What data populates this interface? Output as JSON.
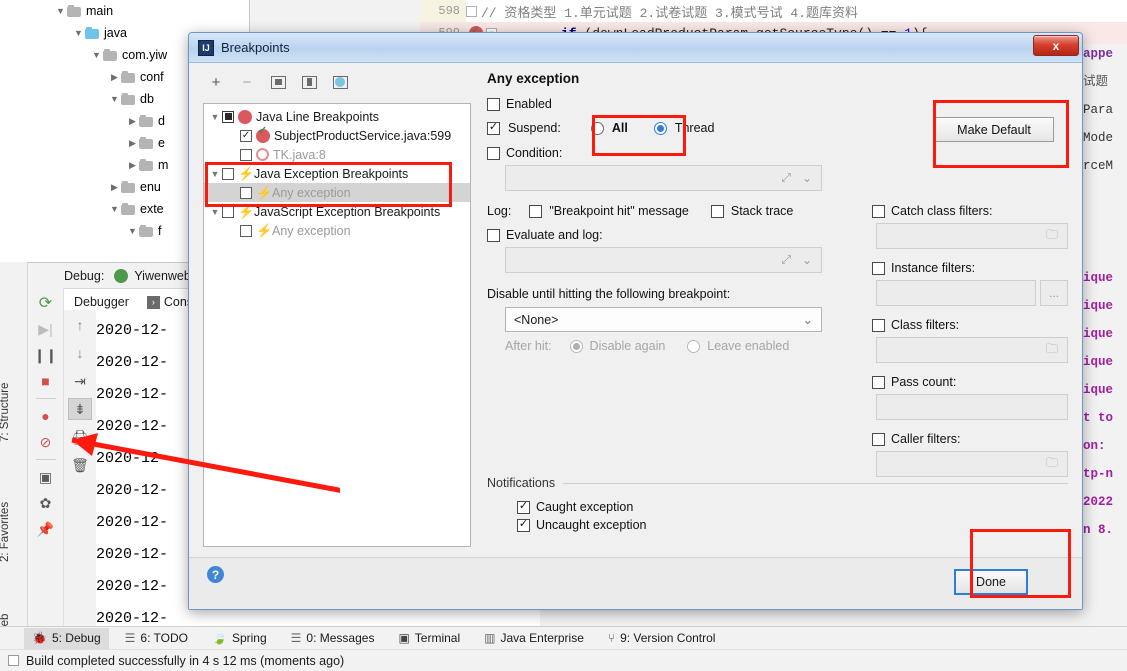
{
  "ide": {
    "project_tree": [
      {
        "indent": 1,
        "arrow": "v",
        "folder": "grey",
        "label": "main"
      },
      {
        "indent": 2,
        "arrow": "v",
        "folder": "blue",
        "label": "java"
      },
      {
        "indent": 3,
        "arrow": "v",
        "folder": "grey",
        "label": "com.yiw"
      },
      {
        "indent": 4,
        "arrow": ">",
        "folder": "grey",
        "label": "conf"
      },
      {
        "indent": 4,
        "arrow": "v",
        "folder": "grey",
        "label": "db"
      },
      {
        "indent": 5,
        "arrow": ">",
        "folder": "grey",
        "label": "d"
      },
      {
        "indent": 5,
        "arrow": ">",
        "folder": "grey",
        "label": "e"
      },
      {
        "indent": 5,
        "arrow": ">",
        "folder": "grey",
        "label": "m"
      },
      {
        "indent": 4,
        "arrow": ">",
        "folder": "grey",
        "label": "enu"
      },
      {
        "indent": 4,
        "arrow": "v",
        "folder": "grey",
        "label": "exte"
      },
      {
        "indent": 5,
        "arrow": "v",
        "folder": "grey",
        "label": "f"
      }
    ],
    "editor": {
      "line_598": {
        "number": "598",
        "comment": "// 资格类型 1.单元试题 2.试卷试题 3.模式号试 4.题库资料"
      },
      "line_599": {
        "number": "599",
        "code_kw": "if",
        "code_rest": " (downLoadProductParam.getSourceType() == ",
        "code_num": "1",
        "code_tail": "){"
      }
    },
    "right_strip": [
      "appe",
      "试题",
      "Para",
      "Mode",
      "rceM",
      "",
      "",
      "",
      "ique",
      "ique",
      "ique",
      "ique",
      "ique",
      "t to",
      "on:",
      "tp-n",
      "2022",
      "n 8."
    ],
    "debug": {
      "label": "Debug:",
      "config_name": "YiwenwebApp",
      "tabs": [
        "Debugger",
        "Cons"
      ],
      "log_lines": [
        "2020-12-",
        "2020-12-",
        "2020-12-",
        "2020-12-",
        "2020-12-",
        "2020-12-",
        "2020-12-",
        "2020-12-",
        "2020-12-",
        "2020-12-"
      ],
      "toolbar_icons": [
        "rerun-icon",
        "resume-icon",
        "pause-icon",
        "stop-icon",
        "view-breakpoints-icon",
        "mute-breakpoints-icon",
        "snapshot-icon",
        "settings-icon",
        "pin-icon"
      ],
      "step_icons": [
        "step-up-icon",
        "step-down-icon",
        "step-out-icon",
        "step-into-selected-icon",
        "export-icon",
        "delete-icon"
      ]
    },
    "left_stripes": [
      "7: Structure",
      "2: Favorites",
      "Web"
    ],
    "bottom_tabs": [
      {
        "icon": "debug-icon",
        "label": "5: Debug",
        "mnemonic": "5",
        "active": true
      },
      {
        "icon": "todo-icon",
        "label": "6: TODO",
        "mnemonic": "6",
        "active": false
      },
      {
        "icon": "spring-icon",
        "label": "Spring",
        "mnemonic": "",
        "active": false
      },
      {
        "icon": "messages-icon",
        "label": "0: Messages",
        "mnemonic": "0",
        "active": false
      },
      {
        "icon": "terminal-icon",
        "label": "Terminal",
        "mnemonic": "",
        "active": false
      },
      {
        "icon": "java-enterprise-icon",
        "label": "Java Enterprise",
        "mnemonic": "",
        "active": false
      },
      {
        "icon": "version-control-icon",
        "label": "9: Version Control",
        "mnemonic": "9",
        "active": false
      }
    ],
    "status_text": "Build completed successfully in 4 s 12 ms (moments ago)"
  },
  "dialog": {
    "title": "Breakpoints",
    "title_icon": "intellij-idea-icon",
    "close_label": "x",
    "toolbar": {
      "add_label": "+",
      "remove_label": "−",
      "icons": [
        "add-icon",
        "remove-icon",
        "group-by-file-icon",
        "save-to-file-icon",
        "view-source-icon"
      ]
    },
    "tree": [
      {
        "arrow": "v",
        "check": "group",
        "icon": "breakpoint-red-dot-icon",
        "label": "Java Line Breakpoints",
        "indent": 0,
        "dim": false,
        "selected": false
      },
      {
        "arrow": "",
        "check": "checked",
        "icon": "breakpoint-verified-icon",
        "label": "SubjectProductService.java:599",
        "indent": 1,
        "dim": false,
        "selected": false
      },
      {
        "arrow": "",
        "check": "unchecked",
        "icon": "breakpoint-hollow-icon",
        "label": "TK.java:8",
        "indent": 1,
        "dim": true,
        "selected": false
      },
      {
        "arrow": "v",
        "check": "unchecked",
        "icon": "exception-bolt-icon",
        "label": "Java Exception Breakpoints",
        "indent": 0,
        "dim": false,
        "selected": false
      },
      {
        "arrow": "",
        "check": "unchecked",
        "icon": "exception-bolt-pale-icon",
        "label": "Any exception",
        "indent": 1,
        "dim": true,
        "selected": true
      },
      {
        "arrow": "v",
        "check": "unchecked",
        "icon": "exception-bolt-icon",
        "label": "JavaScript Exception Breakpoints",
        "indent": 0,
        "dim": false,
        "selected": false
      },
      {
        "arrow": "",
        "check": "unchecked",
        "icon": "exception-bolt-pale-icon",
        "label": "Any exception",
        "indent": 1,
        "dim": true,
        "selected": false
      }
    ],
    "details": {
      "heading": "Any exception",
      "enabled": {
        "label": "Enabled",
        "checked": false,
        "mnemonic_index": 6
      },
      "suspend": {
        "label": "Suspend:",
        "checked": true
      },
      "suspend_all": {
        "label": "All",
        "selected": false
      },
      "suspend_thread": {
        "label": "Thread",
        "selected": true
      },
      "condition": {
        "label": "Condition:",
        "checked": false,
        "value": ""
      },
      "log_prefix": "Log:",
      "log_breakpoint_hit": {
        "label": "\"Breakpoint hit\" message",
        "checked": false
      },
      "log_stack_trace": {
        "label": "Stack trace",
        "checked": false
      },
      "evaluate_and_log": {
        "label": "Evaluate and log:",
        "checked": false,
        "value": ""
      },
      "disable_until_label": "Disable until hitting the following breakpoint:",
      "disable_until_value": "<None>",
      "after_hit_label": "After hit:",
      "after_hit_disable_again": {
        "label": "Disable again",
        "selected": true
      },
      "after_hit_leave_enabled": {
        "label": "Leave enabled",
        "selected": false
      },
      "catch_class_filters": {
        "label": "Catch class filters:",
        "checked": false,
        "value": ""
      },
      "instance_filters": {
        "label": "Instance filters:",
        "checked": false,
        "value": "",
        "button": "..."
      },
      "class_filters": {
        "label": "Class filters:",
        "checked": false,
        "value": ""
      },
      "pass_count": {
        "label": "Pass count:",
        "checked": false,
        "value": ""
      },
      "caller_filters": {
        "label": "Caller filters:",
        "checked": false,
        "value": ""
      },
      "make_default": "Make Default",
      "notifications_title": "Notifications",
      "caught_exception": {
        "label": "Caught exception",
        "checked": true
      },
      "uncaught_exception": {
        "label": "Uncaught exception",
        "checked": true
      }
    },
    "footer": {
      "help_label": "?",
      "done_label": "Done"
    }
  },
  "annotations": {
    "highlight_color": "#fb1a0d",
    "boxes": [
      "make-default-box",
      "thread-radio-box",
      "java-exception-breakpoints-box",
      "done-button-box"
    ],
    "arrow": "pointer-to-view-breakpoints-icon"
  }
}
